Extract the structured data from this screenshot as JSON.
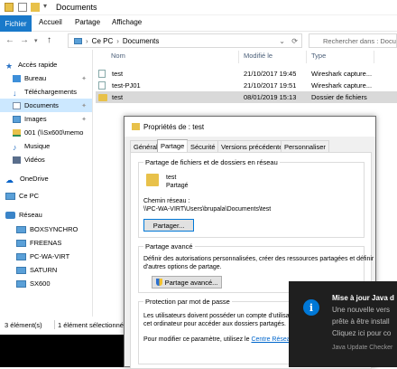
{
  "window": {
    "title": "Documents"
  },
  "ribbon": {
    "tabs": [
      "Fichier",
      "Accueil",
      "Partage",
      "Affichage"
    ]
  },
  "address": {
    "segments": [
      "Ce PC",
      "Documents"
    ],
    "search_placeholder": "Rechercher dans : Docum"
  },
  "sidebar": {
    "items": [
      {
        "label": "Accès rapide",
        "icon": "star-icon"
      },
      {
        "label": "Bureau",
        "icon": "desktop-folder-icon"
      },
      {
        "label": "Téléchargements",
        "icon": "download-icon"
      },
      {
        "label": "Documents",
        "icon": "documents-icon"
      },
      {
        "label": "Images",
        "icon": "pictures-icon"
      },
      {
        "label": "001 (\\\\Sx600\\memo",
        "icon": "network-folder-icon"
      },
      {
        "label": "Musique",
        "icon": "music-icon"
      },
      {
        "label": "Vidéos",
        "icon": "videos-icon"
      },
      {
        "label": "OneDrive",
        "icon": "onedrive-icon"
      },
      {
        "label": "Ce PC",
        "icon": "computer-icon"
      },
      {
        "label": "Réseau",
        "icon": "network-icon"
      },
      {
        "label": "BOXSYNCHRO",
        "icon": "network-computer-icon"
      },
      {
        "label": "FREENAS",
        "icon": "network-computer-icon"
      },
      {
        "label": "PC-WA-VIRT",
        "icon": "network-computer-icon"
      },
      {
        "label": "SATURN",
        "icon": "network-computer-icon"
      },
      {
        "label": "SX600",
        "icon": "network-computer-icon"
      }
    ]
  },
  "filelist": {
    "columns": [
      "Nom",
      "Modifié le",
      "Type"
    ],
    "rows": [
      {
        "name": "test",
        "modified": "21/10/2017 19:45",
        "type": "Wireshark capture..."
      },
      {
        "name": "test-PJ01",
        "modified": "21/10/2017 19:51",
        "type": "Wireshark capture..."
      },
      {
        "name": "test",
        "modified": "08/01/2019 15:13",
        "type": "Dossier de fichiers"
      }
    ]
  },
  "status": {
    "count": "3 élément(s)",
    "selected": "1 élément sélectionné"
  },
  "dialog": {
    "title": "Propriétés de : test",
    "tabs": [
      "Général",
      "Partage",
      "Sécurité",
      "Versions précédentes",
      "Personnaliser"
    ],
    "network_group": {
      "title": "Partage de fichiers et de dossiers en réseau",
      "folder_name": "test",
      "folder_state": "Partagé",
      "path_label": "Chemin réseau :",
      "path_value": "\\\\PC-WA-VIRT\\Users\\brupala\\Documents\\test",
      "button": "Partager..."
    },
    "advanced_group": {
      "title": "Partage avancé",
      "text_line1": "Définir des autorisations personnalisées, créer des ressources partagées et définir",
      "text_line2": "d'autres options de partage.",
      "button": "Partage avancé..."
    },
    "password_group": {
      "title": "Protection par mot de passe",
      "text_line1": "Les utilisateurs doivent posséder un compte d'utilisateur",
      "text_line2": "cet ordinateur pour accéder aux dossiers partagés.",
      "text_line3_prefix": "Pour modifier ce paramètre, utilisez le",
      "link": "Centre Réseau et"
    }
  },
  "toast": {
    "title": "Mise à jour Java d",
    "line1": "Une nouvelle vers",
    "line2": "prête à être install",
    "line3": "Cliquez ici pour co",
    "source": "Java Update Checker"
  },
  "colors": {
    "accent": "#1979ca",
    "selection": "#cce8ff",
    "toast_bg": "#1f1f1f",
    "java_blue": "#0078d7",
    "link": "#0066cc"
  }
}
